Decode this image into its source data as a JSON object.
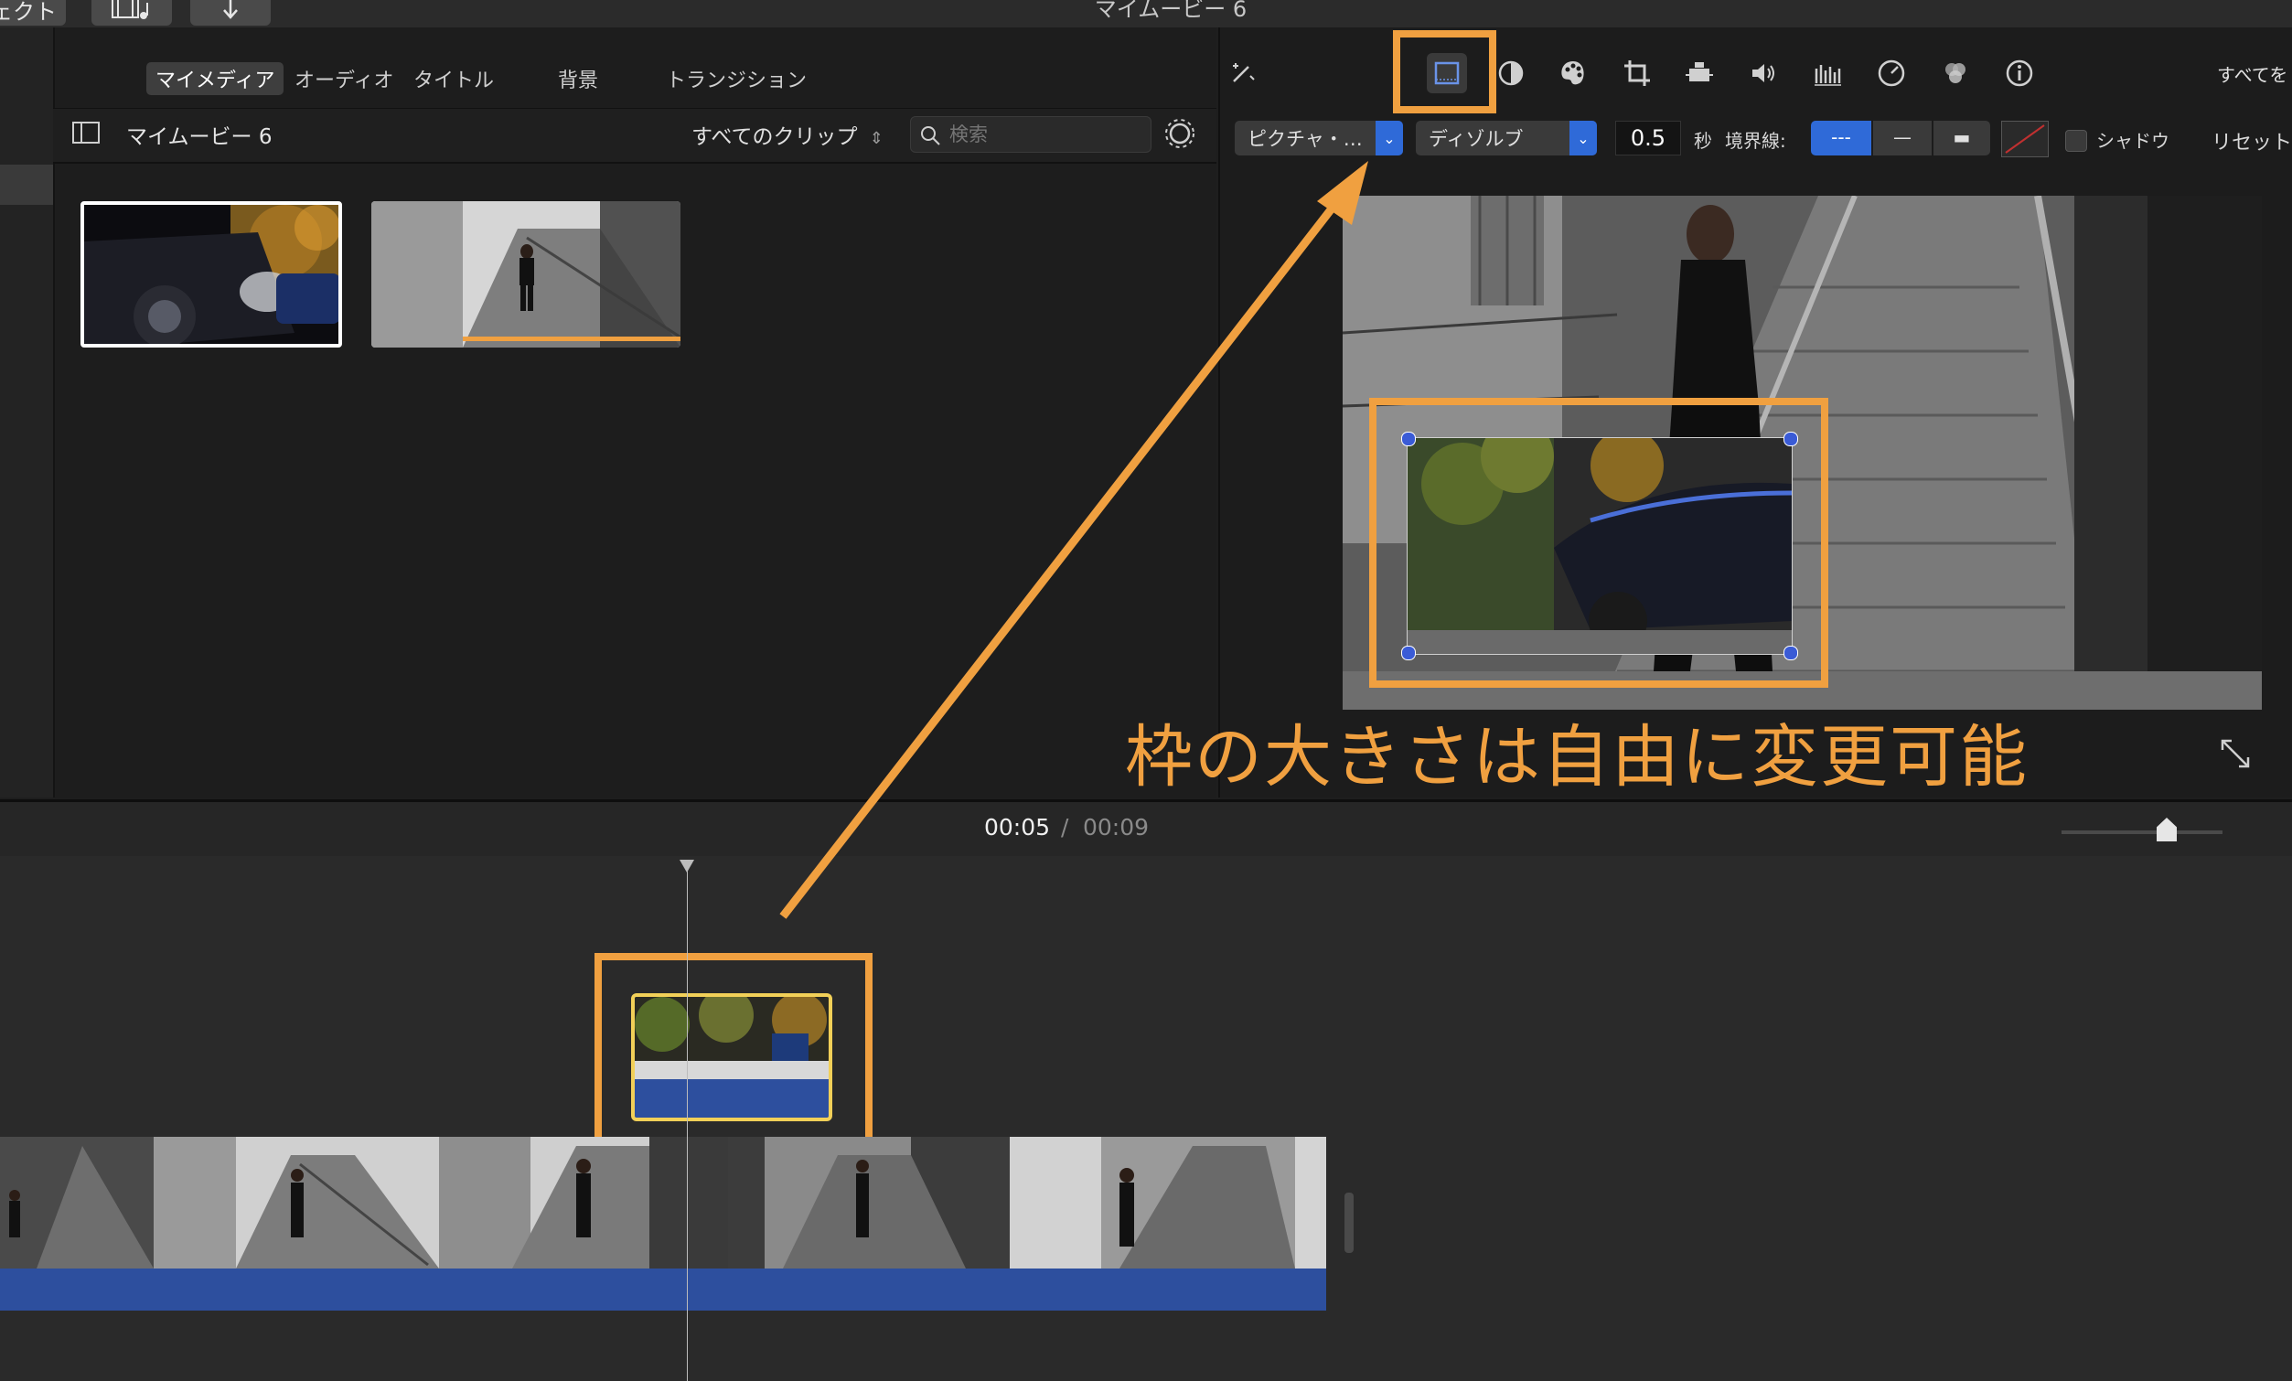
{
  "toolbar": {
    "left_partial_label": "ェクト",
    "film_icon": "film-note-icon",
    "down_icon": "down-arrow-icon",
    "window_title": "マイムービー 6"
  },
  "browser": {
    "tabs": [
      {
        "label": "マイメディア",
        "active": true
      },
      {
        "label": "オーディオ",
        "active": false
      },
      {
        "label": "タイトル",
        "active": false
      },
      {
        "label": "背景",
        "active": false
      },
      {
        "label": "トランジション",
        "active": false
      }
    ],
    "library_name": "マイムービー 6",
    "filter_label": "すべてのクリップ",
    "search_placeholder": "検索"
  },
  "viewer": {
    "reset_all_label": "すべてを",
    "overlay_style": "ピクチャ・…",
    "transition_style": "ディゾルブ",
    "duration_value": "0.5",
    "duration_unit": "秒",
    "border_label": "境界線:",
    "border_options": [
      "---",
      "—",
      "▬"
    ],
    "shadow_label": "シャドウ",
    "reset_label": "リセット",
    "annotation": "枠の大きさは自由に変更可能"
  },
  "timeline": {
    "current_time": "00:05",
    "separator": "/",
    "total_time": "00:09"
  },
  "colors": {
    "accent_orange": "#f0a040",
    "selection_blue": "#2f6ad8",
    "audio_blue": "#2d4f9e"
  }
}
